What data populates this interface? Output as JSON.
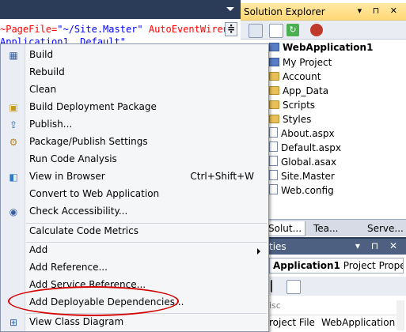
{
  "editor": {
    "line1_parts": [
      "~PageFile=",
      "\"~/Site.Master\"",
      " AutoEventWireup"
    ],
    "line2": "Application1._Default\" "
  },
  "solution_explorer": {
    "title": "Solution Explorer",
    "title_buttons": "▾ ⊓ ✕",
    "root": "WebApplication1",
    "items": [
      {
        "label": "My Project",
        "icon": "project-icon"
      },
      {
        "label": "Account",
        "icon": "folder-icon"
      },
      {
        "label": "App_Data",
        "icon": "folder-icon"
      },
      {
        "label": "Scripts",
        "icon": "folder-icon"
      },
      {
        "label": "Styles",
        "icon": "folder-icon"
      },
      {
        "label": "About.aspx",
        "icon": "page-icon"
      },
      {
        "label": "Default.aspx",
        "icon": "page-icon"
      },
      {
        "label": "Global.asax",
        "icon": "page-icon"
      },
      {
        "label": "Site.Master",
        "icon": "page-icon"
      },
      {
        "label": "Web.config",
        "icon": "page-icon"
      }
    ],
    "tabs": [
      "Solut...",
      "Tea...",
      "Serve..."
    ]
  },
  "properties": {
    "title": "ties",
    "title_buttons": "▾ ⊓ ✕",
    "combo_bold": "Application1",
    "combo_rest": " Project Properti",
    "section": "isc",
    "row_name": "roject File",
    "row_value": "WebApplication"
  },
  "context_menu": {
    "items": [
      {
        "label": "Build",
        "icon": "build-icon"
      },
      {
        "label": "Rebuild",
        "icon": ""
      },
      {
        "label": "Clean",
        "icon": ""
      },
      {
        "label": "Build Deployment Package",
        "icon": "package-icon"
      },
      {
        "label": "Publish...",
        "icon": "publish-icon"
      },
      {
        "label": "Package/Publish Settings",
        "icon": "settings-icon"
      },
      {
        "label": "Run Code Analysis",
        "icon": ""
      },
      {
        "label": "View in Browser",
        "icon": "browser-icon",
        "shortcut": "Ctrl+Shift+W"
      },
      {
        "label": "Convert to Web Application",
        "icon": ""
      },
      {
        "label": "Check Accessibility...",
        "icon": "accessibility-icon"
      },
      {
        "label": "Calculate Code Metrics",
        "icon": ""
      },
      {
        "label": "Add",
        "icon": "",
        "submenu": true
      },
      {
        "label": "Add Reference...",
        "icon": ""
      },
      {
        "label": "Add Service Reference...",
        "icon": ""
      },
      {
        "label": "Add Deployable Dependencies...",
        "icon": ""
      },
      {
        "label": "View Class Diagram",
        "icon": "class-diagram-icon"
      }
    ]
  },
  "colors": {
    "highlight": "#d40000",
    "vs_frame": "#2b3c59"
  }
}
